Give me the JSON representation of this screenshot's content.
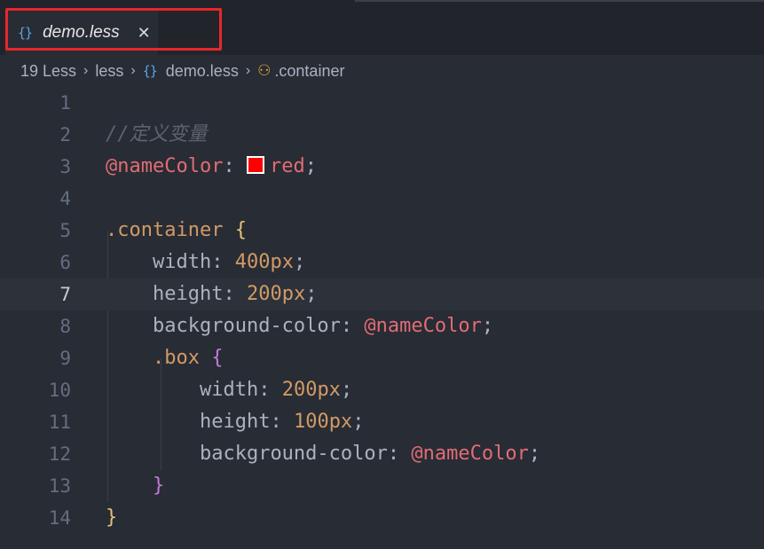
{
  "tab": {
    "icon": "{}",
    "title": "demo.less",
    "close": "✕"
  },
  "breadcrumb": {
    "items": [
      "19 Less",
      "less",
      "demo.less",
      ".container"
    ],
    "sep": "›",
    "file_icon": "{}",
    "class_icon": "⚇"
  },
  "colors": {
    "swatch": "#ff0000",
    "highlight_border": "#e8262b"
  },
  "editor": {
    "active_line": 7,
    "lines": [
      {
        "n": "1"
      },
      {
        "n": "2",
        "comment": "//定义变量"
      },
      {
        "n": "3",
        "var": "@nameColor",
        "colon": ": ",
        "value": "red",
        "semi": ";"
      },
      {
        "n": "4"
      },
      {
        "n": "5",
        "selector": ".container",
        "space": " ",
        "brace": "{"
      },
      {
        "n": "6",
        "indent": "    ",
        "prop": "width",
        "colon": ": ",
        "num": "400px",
        "semi": ";"
      },
      {
        "n": "7",
        "indent": "    ",
        "prop": "height",
        "colon": ": ",
        "num": "200px",
        "semi": ";"
      },
      {
        "n": "8",
        "indent": "    ",
        "prop": "background-color",
        "colon": ": ",
        "var": "@nameColor",
        "semi": ";"
      },
      {
        "n": "9",
        "indent": "    ",
        "selector": ".box",
        "space": " ",
        "brace": "{"
      },
      {
        "n": "10",
        "indent": "        ",
        "prop": "width",
        "colon": ": ",
        "num": "200px",
        "semi": ";"
      },
      {
        "n": "11",
        "indent": "        ",
        "prop": "height",
        "colon": ": ",
        "num": "100px",
        "semi": ";"
      },
      {
        "n": "12",
        "indent": "        ",
        "prop": "background-color",
        "colon": ": ",
        "var": "@nameColor",
        "semi": ";"
      },
      {
        "n": "13",
        "indent": "    ",
        "brace": "}"
      },
      {
        "n": "14",
        "brace": "}"
      }
    ]
  }
}
